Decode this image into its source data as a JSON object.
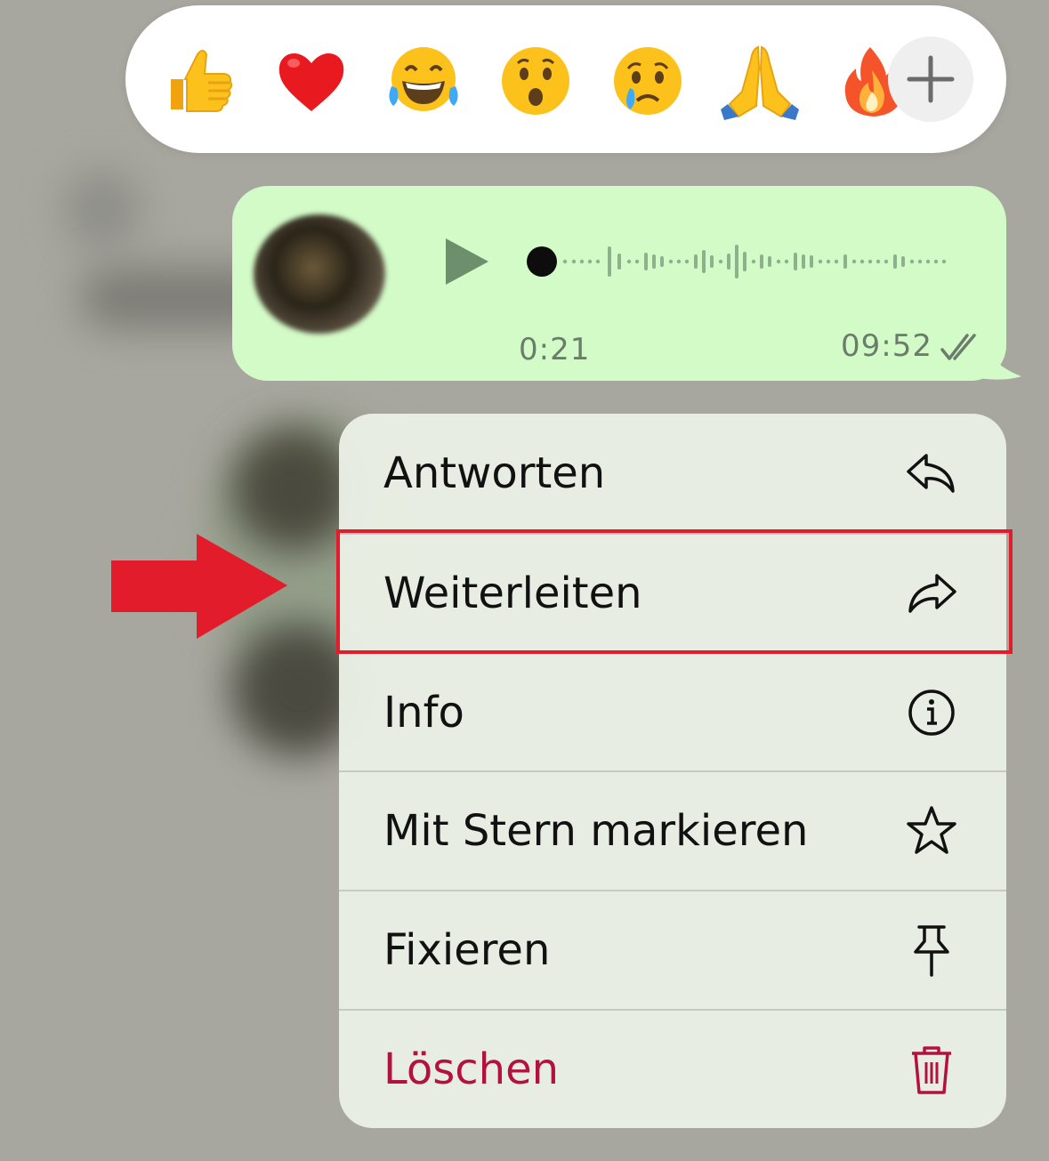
{
  "reactions": {
    "items": [
      {
        "emoji": "👍",
        "name": "thumbs-up"
      },
      {
        "emoji": "❤️",
        "name": "heart"
      },
      {
        "emoji": "😂",
        "name": "laughing"
      },
      {
        "emoji": "😮",
        "name": "surprised"
      },
      {
        "emoji": "😢",
        "name": "crying"
      },
      {
        "emoji": "🙏",
        "name": "praying"
      },
      {
        "emoji": "🔥",
        "name": "fire"
      }
    ],
    "more_icon": "plus-icon"
  },
  "voice_message": {
    "duration": "0:21",
    "time": "09:52",
    "status_icon": "double-check-icon",
    "bubble_color": "#d3fbc8"
  },
  "menu": {
    "items": [
      {
        "label": "Antworten",
        "icon": "reply-icon"
      },
      {
        "label": "Weiterleiten",
        "icon": "forward-icon",
        "highlighted": true
      },
      {
        "label": "Info",
        "icon": "info-icon"
      },
      {
        "label": "Mit Stern markieren",
        "icon": "star-icon"
      },
      {
        "label": "Fixieren",
        "icon": "pin-icon"
      },
      {
        "label": "Löschen",
        "icon": "trash-icon",
        "destructive": true
      }
    ],
    "destructive_color": "#b3123f",
    "highlight_color": "#e21c2a"
  }
}
